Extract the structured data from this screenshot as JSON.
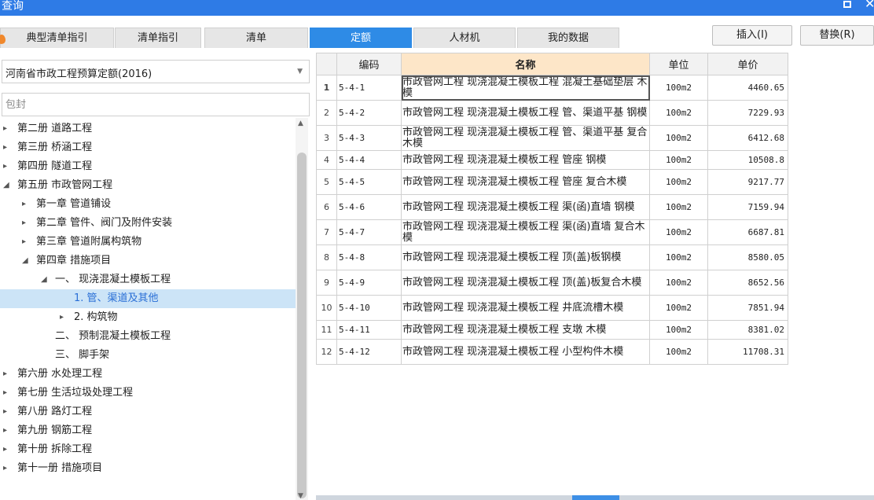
{
  "window": {
    "title": "查询"
  },
  "tabs": [
    {
      "label": "典型清单指引",
      "active": false
    },
    {
      "label": "清单指引",
      "active": false
    },
    {
      "label": "清单",
      "active": false
    },
    {
      "label": "定额",
      "active": true
    },
    {
      "label": "人材机",
      "active": false
    },
    {
      "label": "我的数据",
      "active": false
    }
  ],
  "actions": {
    "insert": "插入(I)",
    "replace": "替换(R)"
  },
  "left": {
    "selected_db": "河南省市政工程预算定额(2016)",
    "search_value": "",
    "search_placeholder": "包封",
    "tree": [
      {
        "label": "第二册 道路工程",
        "level": 0,
        "state": "collapsed"
      },
      {
        "label": "第三册 桥涵工程",
        "level": 0,
        "state": "collapsed"
      },
      {
        "label": "第四册 隧道工程",
        "level": 0,
        "state": "collapsed"
      },
      {
        "label": "第五册 市政管网工程",
        "level": 0,
        "state": "expanded"
      },
      {
        "label": "第一章 管道铺设",
        "level": 1,
        "state": "collapsed"
      },
      {
        "label": "第二章 管件、阀门及附件安装",
        "level": 1,
        "state": "collapsed"
      },
      {
        "label": "第三章 管道附属构筑物",
        "level": 1,
        "state": "collapsed"
      },
      {
        "label": "第四章 措施项目",
        "level": 1,
        "state": "expanded"
      },
      {
        "label": "一、 现浇混凝土模板工程",
        "level": 2,
        "state": "expanded"
      },
      {
        "label": "1. 管、渠道及其他",
        "level": 3,
        "state": "leaf",
        "selected": true
      },
      {
        "label": "2. 构筑物",
        "level": 3,
        "state": "collapsed"
      },
      {
        "label": "二、 预制混凝土模板工程",
        "level": 2,
        "state": "leaf"
      },
      {
        "label": "三、 脚手架",
        "level": 2,
        "state": "leaf"
      },
      {
        "label": "第六册 水处理工程",
        "level": 0,
        "state": "collapsed"
      },
      {
        "label": "第七册 生活垃圾处理工程",
        "level": 0,
        "state": "collapsed"
      },
      {
        "label": "第八册 路灯工程",
        "level": 0,
        "state": "collapsed"
      },
      {
        "label": "第九册 钢筋工程",
        "level": 0,
        "state": "collapsed"
      },
      {
        "label": "第十册 拆除工程",
        "level": 0,
        "state": "collapsed"
      },
      {
        "label": "第十一册 措施项目",
        "level": 0,
        "state": "collapsed"
      }
    ]
  },
  "grid": {
    "columns": [
      "编码",
      "名称",
      "单位",
      "单价"
    ],
    "rows": [
      {
        "num": "1",
        "code": "5-4-1",
        "name": "市政管网工程 现浇混凝土模板工程 混凝土基础垫层 木模",
        "unit": "100m2",
        "price": "4460.65"
      },
      {
        "num": "2",
        "code": "5-4-2",
        "name": "市政管网工程 现浇混凝土模板工程 管、渠道平基 钢模",
        "unit": "100m2",
        "price": "7229.93"
      },
      {
        "num": "3",
        "code": "5-4-3",
        "name": "市政管网工程 现浇混凝土模板工程 管、渠道平基 复合木模",
        "unit": "100m2",
        "price": "6412.68"
      },
      {
        "num": "4",
        "code": "5-4-4",
        "name": "市政管网工程 现浇混凝土模板工程 管座 钢模",
        "unit": "100m2",
        "price": "10508.8"
      },
      {
        "num": "5",
        "code": "5-4-5",
        "name": "市政管网工程 现浇混凝土模板工程 管座 复合木模",
        "unit": "100m2",
        "price": "9217.77"
      },
      {
        "num": "6",
        "code": "5-4-6",
        "name": "市政管网工程 现浇混凝土模板工程 渠(函)直墙 钢模",
        "unit": "100m2",
        "price": "7159.94"
      },
      {
        "num": "7",
        "code": "5-4-7",
        "name": "市政管网工程 现浇混凝土模板工程 渠(函)直墙 复合木模",
        "unit": "100m2",
        "price": "6687.81"
      },
      {
        "num": "8",
        "code": "5-4-8",
        "name": "市政管网工程 现浇混凝土模板工程 顶(盖)板钢模",
        "unit": "100m2",
        "price": "8580.05"
      },
      {
        "num": "9",
        "code": "5-4-9",
        "name": "市政管网工程 现浇混凝土模板工程 顶(盖)板复合木模",
        "unit": "100m2",
        "price": "8652.56"
      },
      {
        "num": "10",
        "code": "5-4-10",
        "name": "市政管网工程 现浇混凝土模板工程 井底流槽木模",
        "unit": "100m2",
        "price": "7851.94"
      },
      {
        "num": "11",
        "code": "5-4-11",
        "name": "市政管网工程 现浇混凝土模板工程 支墩 木模",
        "unit": "100m2",
        "price": "8381.02"
      },
      {
        "num": "12",
        "code": "5-4-12",
        "name": "市政管网工程 现浇混凝土模板工程 小型构件木模",
        "unit": "100m2",
        "price": "11708.31"
      }
    ]
  },
  "colors": {
    "accent": "#2e8be6",
    "selected_row": "#cce4f7",
    "name_header": "#fde6c8"
  }
}
